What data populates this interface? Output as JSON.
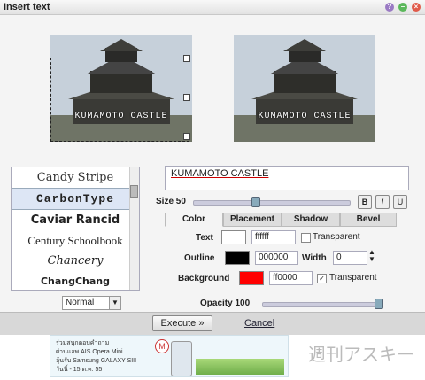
{
  "window": {
    "title": "Insert text"
  },
  "preview": {
    "caption": "KUMAMOTO CASTLE"
  },
  "fonts": [
    "Candy Stripe",
    "CarbonType",
    "Caviar Rancid",
    "Century Schoolbook",
    "Chancery",
    "ChangChang"
  ],
  "text_value": "KUMAMOTO CASTLE",
  "size": {
    "label": "Size 50",
    "level": 50
  },
  "style_buttons": {
    "bold": "B",
    "italic": "I",
    "underline": "U"
  },
  "tabs": [
    "Color",
    "Placement",
    "Shadow",
    "Bevel"
  ],
  "color": {
    "text_label": "Text",
    "text_hex": "ffffff",
    "text_color": "#ffffff",
    "transparent_label": "Transparent",
    "outline_label": "Outline",
    "outline_hex": "000000",
    "outline_color": "#000000",
    "width_label": "Width",
    "width_value": "0",
    "background_label": "Background",
    "background_hex": "ff0000",
    "background_color": "#ff0000"
  },
  "blend_mode": "Normal",
  "opacity": {
    "label": "Opacity 100"
  },
  "actions": {
    "execute": "Execute »",
    "cancel": "Cancel"
  },
  "ad": {
    "line1": "ร่วมสนุกตอบคำถาม",
    "line2": "ผ่านแอพ AIS Opera Mini",
    "line3": "ลุ้นรับ Samsung GALAXY SIII",
    "line4": "วันนี้ - 15 ต.ค. 55",
    "watermark": "週刊アスキー"
  }
}
